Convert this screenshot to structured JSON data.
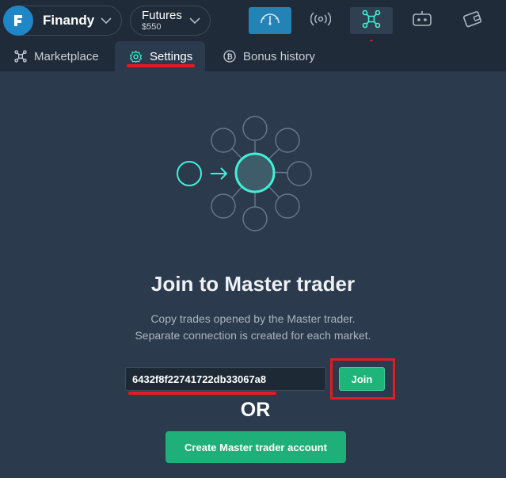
{
  "topbar": {
    "brand": {
      "name": "Finandy",
      "logo_letter": "F"
    },
    "account": {
      "title": "Futures",
      "balance": "$550"
    },
    "icons": [
      {
        "name": "gauge-icon",
        "active": true
      },
      {
        "name": "signal-icon",
        "active": false
      },
      {
        "name": "network-icon",
        "active": true
      },
      {
        "name": "bot-icon",
        "active": false
      },
      {
        "name": "wallet-icon",
        "active": false
      }
    ]
  },
  "tabs": {
    "marketplace": "Marketplace",
    "settings": "Settings",
    "bonus_history": "Bonus history",
    "active": "settings"
  },
  "main": {
    "heading": "Join to Master trader",
    "description_line1": "Copy trades opened by the Master trader.",
    "description_line2": "Separate connection is created for each market.",
    "code_value": "6432f8f22741722db33067a8",
    "join_label": "Join",
    "or_label": "OR",
    "create_label": "Create Master trader account"
  },
  "colors": {
    "background": "#2b3a4d",
    "topbar": "#1f2b38",
    "accent_green": "#1db57a",
    "accent_cyan": "#3ff2d6",
    "brand_blue": "#1f86c8",
    "annotation_red": "#e31b23"
  }
}
